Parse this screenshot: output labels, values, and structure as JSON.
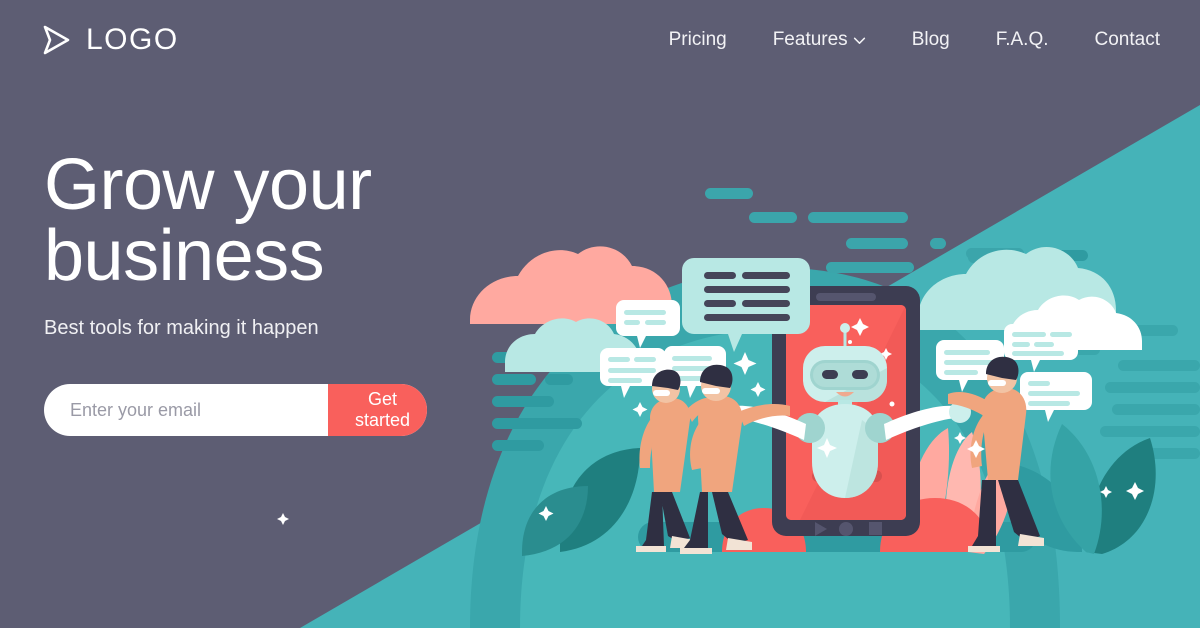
{
  "brand": {
    "logo_text": "LOGO",
    "logo_icon": "send-arrow-icon"
  },
  "nav": {
    "items": [
      {
        "label": "Pricing",
        "has_dropdown": false
      },
      {
        "label": "Features",
        "has_dropdown": true,
        "icon": "chevron-down-icon"
      },
      {
        "label": "Blog",
        "has_dropdown": false
      },
      {
        "label": "F.A.Q.",
        "has_dropdown": false
      },
      {
        "label": "Contact",
        "has_dropdown": false
      }
    ]
  },
  "hero": {
    "headline_line1": "Grow your",
    "headline_line2": "business",
    "subheadline": "Best tools for making it happen",
    "email_placeholder": "Enter your email",
    "email_value": "",
    "cta_label": "Get started"
  },
  "illustration": {
    "alt": "chatbot on smartphone with people and chat bubbles",
    "phone_controls": [
      "play-icon",
      "record-icon",
      "stop-icon"
    ]
  },
  "colors": {
    "background": "#5d5d73",
    "teal": "#45b3b8",
    "teal_dark": "#2f9296",
    "teal_deep": "#1f7f7f",
    "coral": "#f9605c",
    "pink": "#ffa9a0",
    "mint": "#b8e8e4",
    "white": "#ffffff",
    "slate": "#454559"
  }
}
